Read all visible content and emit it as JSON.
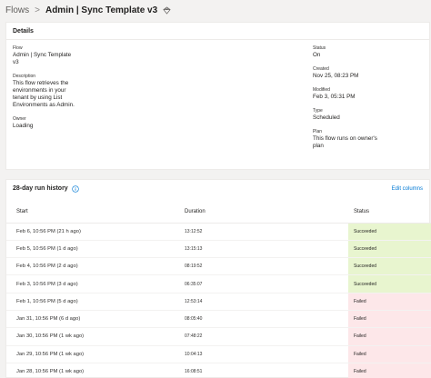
{
  "breadcrumb": {
    "parent": "Flows",
    "separator": ">",
    "current": "Admin | Sync Template v3"
  },
  "details": {
    "title": "Details",
    "flow_label": "Flow",
    "flow_value": "Admin | Sync Template v3",
    "description_label": "Description",
    "description_value": "This flow retrieves the environments in your tenant by using List Environments as Admin.",
    "owner_label": "Owner",
    "owner_value": "Loading",
    "status_label": "Status",
    "status_value": "On",
    "created_label": "Created",
    "created_value": "Nov 25, 08:23 PM",
    "modified_label": "Modified",
    "modified_value": "Feb 3, 05:31 PM",
    "type_label": "Type",
    "type_value": "Scheduled",
    "plan_label": "Plan",
    "plan_value": "This flow runs on owner's plan"
  },
  "history": {
    "title": "28-day run history",
    "edit_columns": "Edit columns",
    "columns": {
      "start": "Start",
      "duration": "Duration",
      "status": "Status"
    },
    "rows": [
      {
        "start": "Feb 6, 10:56 PM (21 h ago)",
        "duration": "13:12:52",
        "status": "Succeeded"
      },
      {
        "start": "Feb 5, 10:56 PM (1 d ago)",
        "duration": "13:15:13",
        "status": "Succeeded"
      },
      {
        "start": "Feb 4, 10:56 PM (2 d ago)",
        "duration": "08:19:52",
        "status": "Succeeded"
      },
      {
        "start": "Feb 3, 10:56 PM (3 d ago)",
        "duration": "06:35:07",
        "status": "Succeeded"
      },
      {
        "start": "Feb 1, 10:56 PM (5 d ago)",
        "duration": "12:53:14",
        "status": "Failed"
      },
      {
        "start": "Jan 31, 10:56 PM (6 d ago)",
        "duration": "08:05:40",
        "status": "Failed"
      },
      {
        "start": "Jan 30, 10:56 PM (1 wk ago)",
        "duration": "07:48:22",
        "status": "Failed"
      },
      {
        "start": "Jan 29, 10:56 PM (1 wk ago)",
        "duration": "10:04:13",
        "status": "Failed"
      },
      {
        "start": "Jan 28, 10:56 PM (1 wk ago)",
        "duration": "16:08:51",
        "status": "Failed"
      }
    ]
  },
  "colors": {
    "succeeded_bg": "#e8f5cf",
    "failed_bg": "#fde7e9",
    "link": "#0078d4"
  },
  "icons": {
    "breadcrumb_separator": "chevron-right-icon",
    "title_icon": "diamond-icon",
    "history_info": "info-icon"
  }
}
